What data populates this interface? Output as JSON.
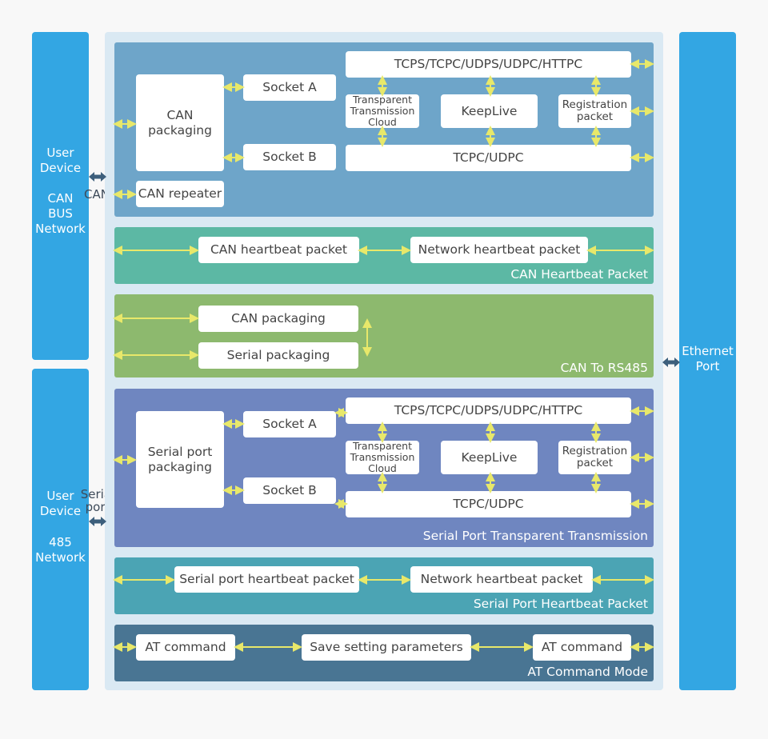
{
  "colors": {
    "page_bg": "#f8f8f8",
    "side_blue": "#33a6e3",
    "center_bg": "#dae9f3",
    "can_panel": "#6ea5c9",
    "can_heartbeat_panel": "#5cb8a4",
    "can_rs485_panel": "#8db96e",
    "serial_panel": "#6f86c0",
    "serial_heartbeat_panel": "#4ba4b4",
    "at_panel": "#497593",
    "arrow_yellow": "#e8e86a",
    "connector_dark": "#3d5f7c"
  },
  "left_top": {
    "line1": "User",
    "line2": "Device",
    "line3": "CAN",
    "line4": "BUS",
    "line5": "Network",
    "connector_label": "CAN"
  },
  "left_bottom": {
    "line1": "User",
    "line2": "Device",
    "line3": "485",
    "line4": "Network",
    "connector_label_1": "Serial",
    "connector_label_2": "port"
  },
  "right": {
    "line1": "Ethernet",
    "line2": "Port"
  },
  "can_section": {
    "packaging_1": "CAN",
    "packaging_2": "packaging",
    "socket_a": "Socket A",
    "socket_b": "Socket B",
    "repeater": "CAN repeater",
    "protocols": "TCPS/TCPC/UDPS/UDPC/HTTPC",
    "cloud_1": "Transparent",
    "cloud_2": "Transmission",
    "cloud_3": "Cloud",
    "keeplive": "KeepLive",
    "registration_1": "Registration",
    "registration_2": "packet",
    "tcpc_udpc": "TCPC/UDPC"
  },
  "can_heartbeat": {
    "box1": "CAN heartbeat packet",
    "box2": "Network heartbeat packet",
    "title": "CAN Heartbeat Packet"
  },
  "can_rs485": {
    "box1": "CAN packaging",
    "box2": "Serial packaging",
    "title": "CAN To RS485"
  },
  "serial_section": {
    "packaging_1": "Serial port",
    "packaging_2": "packaging",
    "socket_a": "Socket A",
    "socket_b": "Socket B",
    "protocols": "TCPS/TCPC/UDPS/UDPC/HTTPC",
    "cloud_1": "Transparent",
    "cloud_2": "Transmission",
    "cloud_3": "Cloud",
    "keeplive": "KeepLive",
    "registration_1": "Registration",
    "registration_2": "packet",
    "tcpc_udpc": "TCPC/UDPC",
    "title": "Serial Port Transparent Transmission"
  },
  "serial_heartbeat": {
    "box1": "Serial port heartbeat packet",
    "box2": "Network heartbeat packet",
    "title": "Serial Port Heartbeat Packet"
  },
  "at_mode": {
    "box1": "AT command",
    "box2": "Save setting parameters",
    "box3": "AT command",
    "title": "AT Command Mode"
  }
}
